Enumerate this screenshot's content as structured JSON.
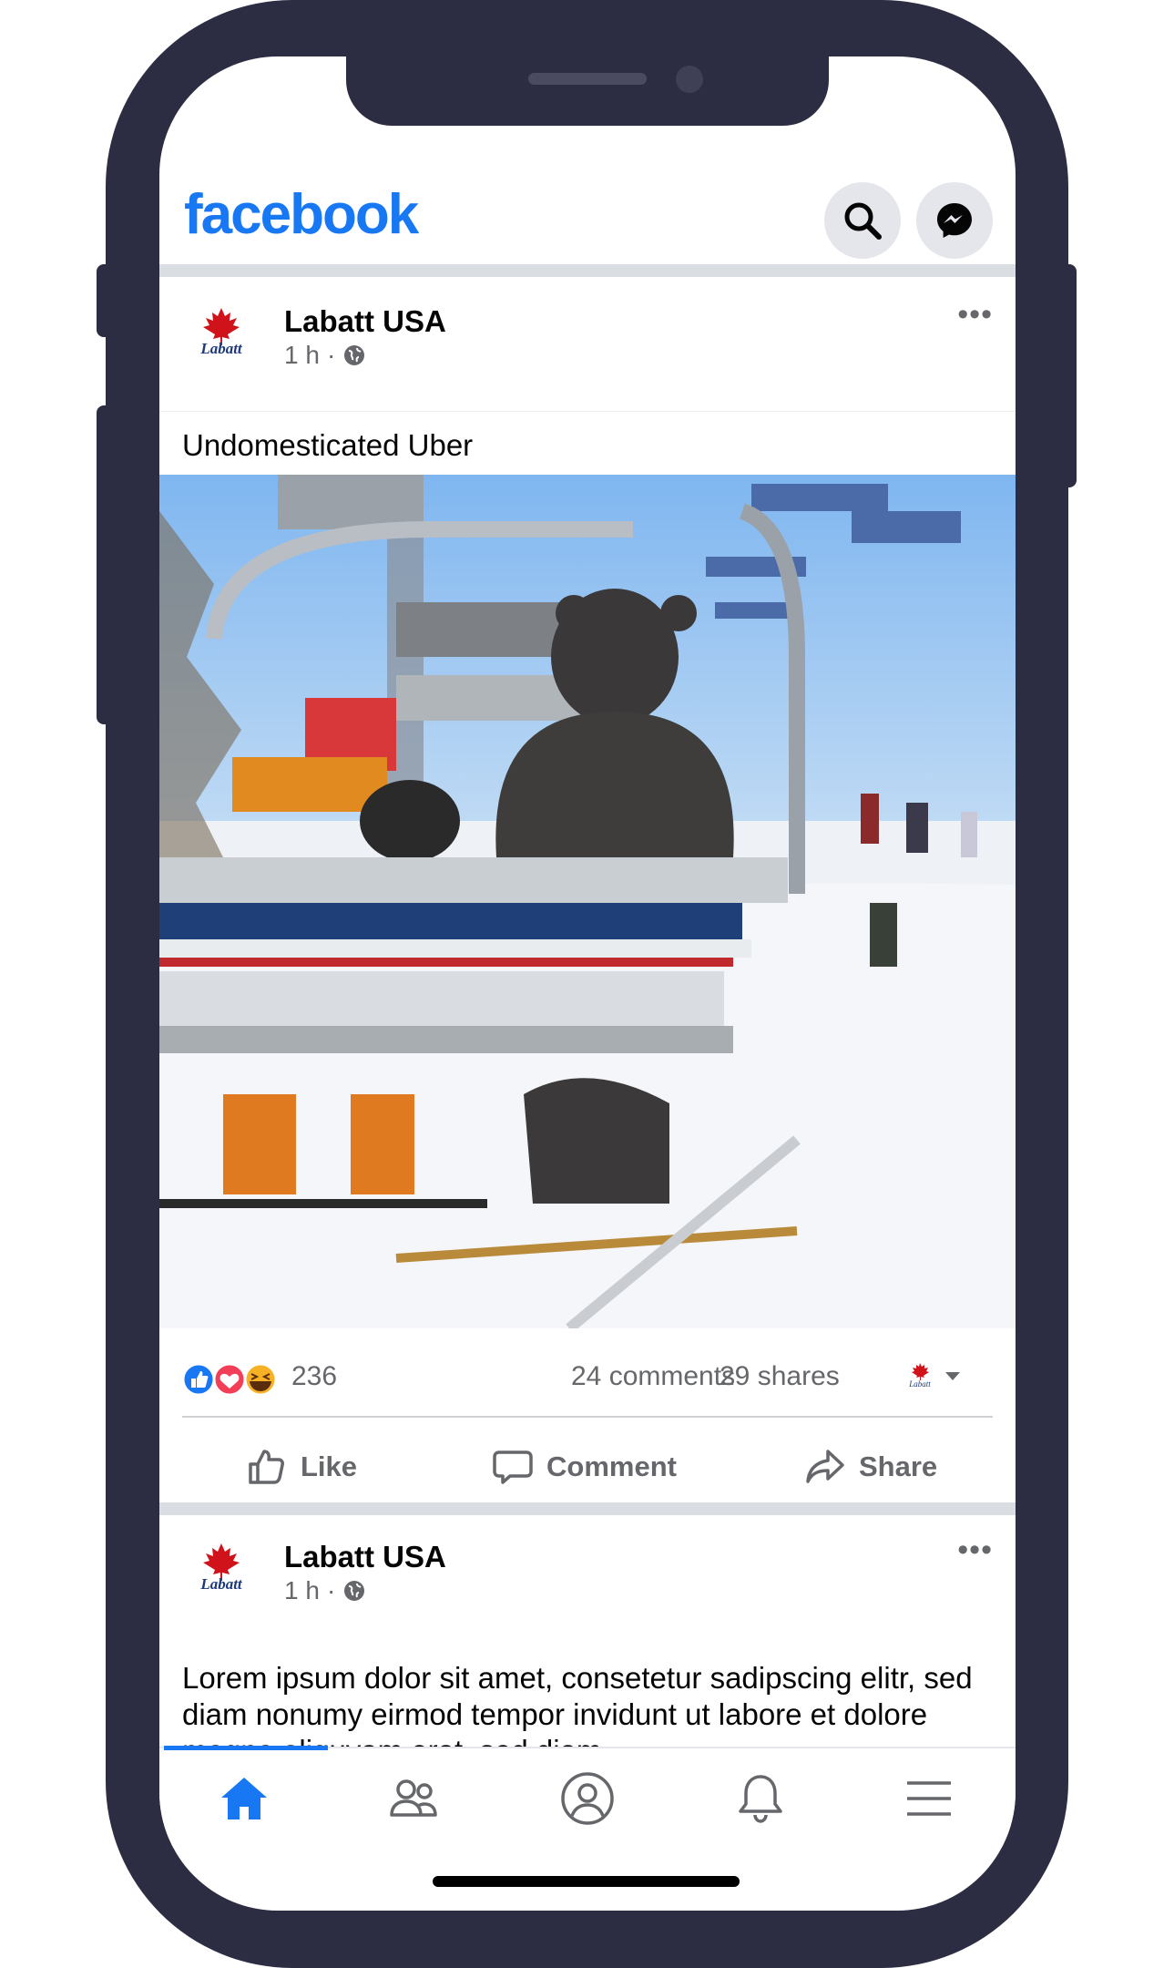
{
  "app": {
    "logo_text": "facebook",
    "brand_color": "#1877f2"
  },
  "header": {
    "icons": [
      "search-icon",
      "messenger-icon"
    ]
  },
  "post1": {
    "author": "Labatt USA",
    "time": "1 h",
    "caption": "Undomesticated Uber",
    "reactions": {
      "types": [
        "like",
        "love",
        "haha"
      ],
      "count": "236"
    },
    "comments": "24 comments",
    "shares": "29 shares",
    "actions": {
      "like": "Like",
      "comment": "Comment",
      "share": "Share"
    }
  },
  "post2": {
    "author": "Labatt USA",
    "time": "1 h",
    "text": "Lorem ipsum dolor sit amet, consetetur sadipscing elitr, sed diam nonumy eirmod tempor invidunt ut labore et dolore magna aliquyam erat, sed diam"
  },
  "bottom_nav": {
    "items": [
      "home-icon",
      "friends-icon",
      "profile-icon",
      "notifications-icon",
      "menu-icon"
    ],
    "active": "home-icon"
  }
}
